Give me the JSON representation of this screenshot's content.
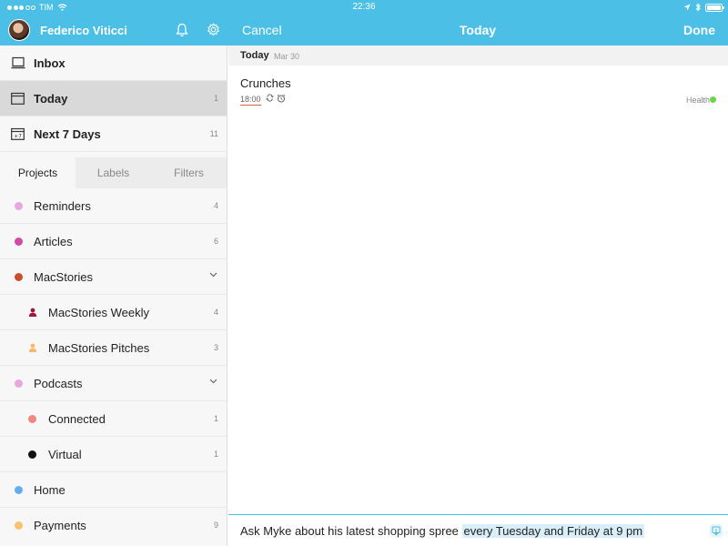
{
  "status_bar": {
    "carrier": "TIM",
    "time": "22:36"
  },
  "sidebar": {
    "user_name": "Federico Viticci",
    "nav": [
      {
        "label": "Inbox",
        "count": "",
        "icon": "inbox-icon"
      },
      {
        "label": "Today",
        "count": "1",
        "icon": "calendar-icon"
      },
      {
        "label": "Next 7 Days",
        "count": "11",
        "icon": "calendar-plus7-icon"
      }
    ],
    "tabs": [
      "Projects",
      "Labels",
      "Filters"
    ],
    "projects": [
      {
        "label": "Reminders",
        "count": "4",
        "color": "#e8a6e3"
      },
      {
        "label": "Articles",
        "count": "6",
        "color": "#d14aa8"
      },
      {
        "label": "MacStories",
        "count": "",
        "color": "#c8502c"
      },
      {
        "label": "MacStories Weekly",
        "count": "4",
        "color": "#9c1b3c"
      },
      {
        "label": "MacStories Pitches",
        "count": "3",
        "color": "#f6b96a"
      },
      {
        "label": "Podcasts",
        "count": "",
        "color": "#e8a6e3"
      },
      {
        "label": "Connected",
        "count": "1",
        "color": "#f08880"
      },
      {
        "label": "Virtual",
        "count": "1",
        "color": "#111111"
      },
      {
        "label": "Home",
        "count": "",
        "color": "#63aef0"
      },
      {
        "label": "Payments",
        "count": "9",
        "color": "#fac06f"
      }
    ]
  },
  "nav_bar": {
    "cancel": "Cancel",
    "title": "Today",
    "done": "Done"
  },
  "main": {
    "section_title": "Today",
    "section_date": "Mar 30",
    "task": {
      "name": "Crunches",
      "time": "18:00",
      "label": "Health",
      "label_color": "#67d64a"
    },
    "input": {
      "text": "Ask Myke about his latest shopping spree",
      "highlight": "every Tuesday and Friday at 9 pm"
    }
  },
  "colors": {
    "accent": "#4cbfe6"
  }
}
